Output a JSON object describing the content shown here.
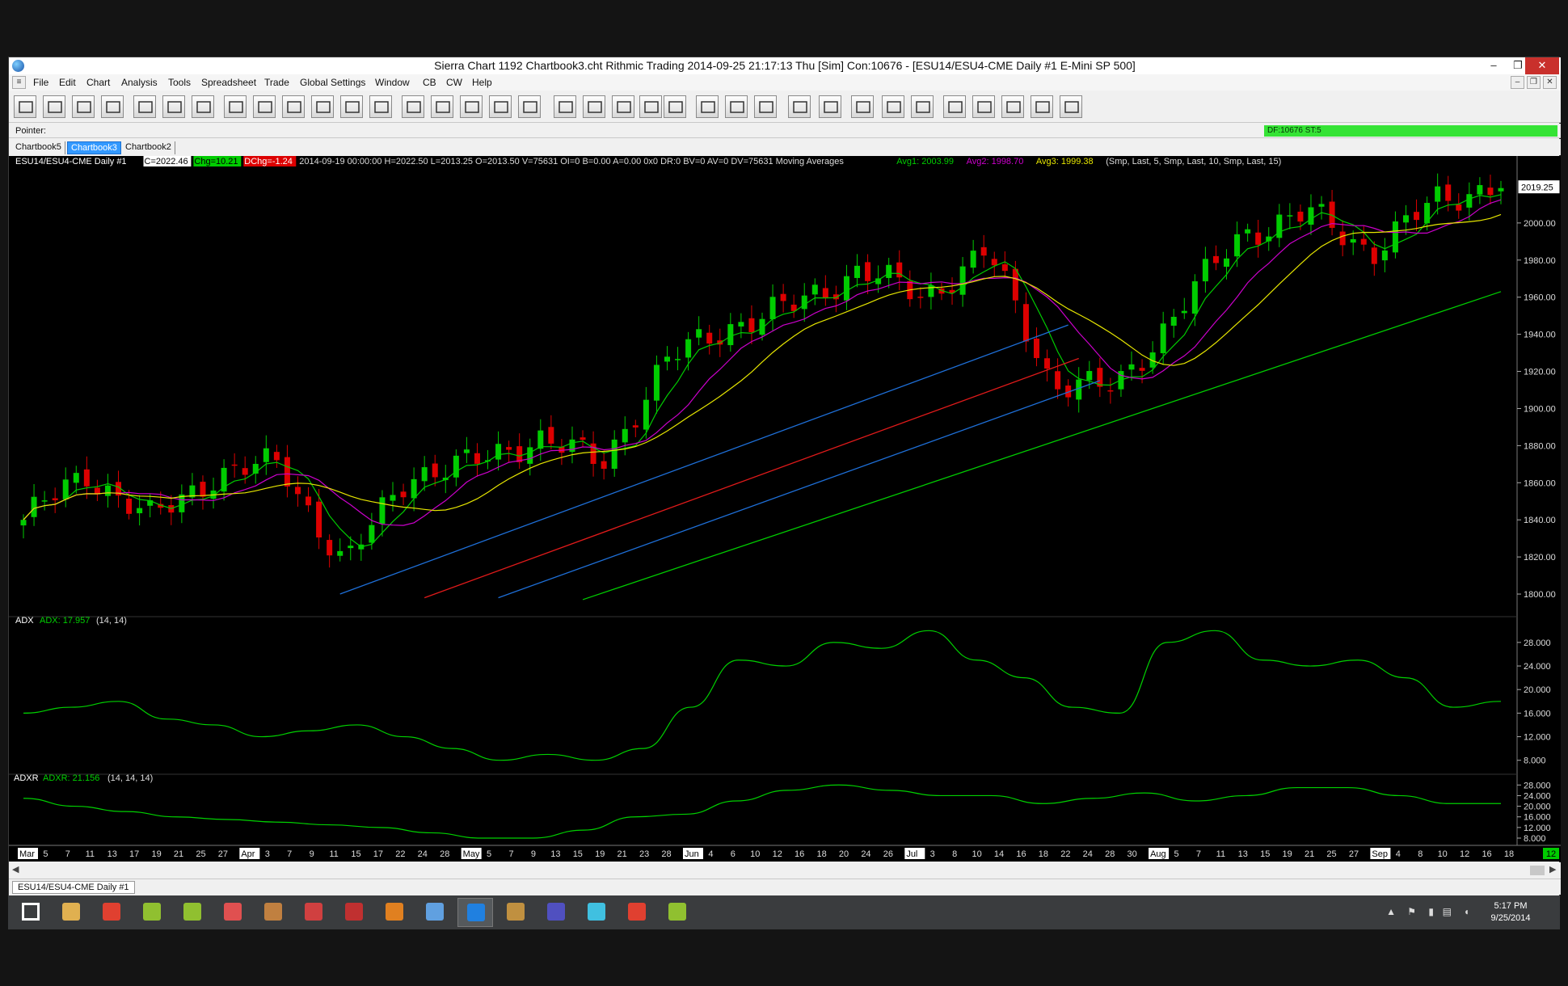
{
  "window": {
    "title": "Sierra Chart 1192 Chartbook3.cht  Rithmic Trading 2014-09-25  21:17:13 Thu [Sim]  Con:10676 - [ESU14/ESU4-CME  Daily  #1  E-Mini SP 500]",
    "minimize_glyph": "–",
    "restore_glyph": "❐",
    "close_glyph": "✕"
  },
  "menu": [
    "File",
    "Edit",
    "Chart",
    "Analysis",
    "Tools",
    "Spreadsheet",
    "Trade",
    "Global Settings",
    "Window",
    "CB",
    "CW",
    "Help"
  ],
  "pointer_bar": {
    "label": "Pointer:",
    "status": "DF:10676  ST:5",
    "status_color": "#35e335"
  },
  "tabs": [
    "Chartbook5",
    "Chartbook3",
    "Chartbook2"
  ],
  "active_tab": "Chartbook3",
  "chart": {
    "header_symbol": "ESU14/ESU4-CME  Daily  #1",
    "header_close": "C=2022.46",
    "header_change": "Chg=10.21",
    "header_pchange": "DChg=-1.24",
    "header_ohlc": "2014-09-19 00:00:00 H=2022.50 L=2013.25 O=2013.50 V=75631 OI=0 B=0.00 A=0.00 0x0 DR:0 BV=0 AV=0 DV=75631 Moving Averages",
    "avg1": "Avg1: 2003.99",
    "avg2": "Avg2: 1998.70",
    "avg3": "Avg3: 1999.38",
    "ma_params": "(Smp, Last, 5, Smp, Last, 10, Smp, Last, 15)",
    "last_price": "2019.25",
    "price_labels": [
      "2000.00",
      "1980.00",
      "1960.00",
      "1940.00",
      "1920.00",
      "1900.00",
      "1880.00",
      "1860.00",
      "1840.00",
      "1820.00",
      "1800.00"
    ],
    "adx_title": "ADX",
    "adx_value": "ADX: 17.957",
    "adx_params": "(14, 14)",
    "adx_labels": [
      "28.000",
      "24.000",
      "20.000",
      "16.000",
      "12.000",
      "8.000"
    ],
    "adxr_title": "ADXR",
    "adxr_value": "ADXR: 21.156",
    "adxr_params": "(14, 14, 14)",
    "adxr_labels": [
      "28.000",
      "24.000",
      "20.000",
      "16.000",
      "12.000",
      "8.000"
    ],
    "date_labels": [
      "Mar",
      "5",
      "7",
      "11",
      "13",
      "17",
      "19",
      "21",
      "25",
      "27",
      "Apr",
      "3",
      "7",
      "9",
      "11",
      "15",
      "17",
      "22",
      "24",
      "28",
      "May",
      "5",
      "7",
      "9",
      "13",
      "15",
      "19",
      "21",
      "23",
      "28",
      "Jun",
      "4",
      "6",
      "10",
      "12",
      "16",
      "18",
      "20",
      "24",
      "26",
      "Jul",
      "3",
      "8",
      "10",
      "14",
      "16",
      "18",
      "22",
      "24",
      "28",
      "30",
      "Aug",
      "5",
      "7",
      "11",
      "13",
      "15",
      "19",
      "21",
      "25",
      "27",
      "Sep",
      "4",
      "8",
      "10",
      "12",
      "16",
      "18"
    ],
    "corner_label": "12",
    "colors": {
      "up_candle": "#00cc00",
      "down_candle": "#dd0000",
      "avg1": "#00cc00",
      "avg2": "#cc00cc",
      "avg3": "#e6e600",
      "trend_blue": "#1e6fd8",
      "trend_red": "#e01a1a",
      "trend_green": "#00cc00",
      "indicator": "#00d000"
    }
  },
  "chart_data": {
    "type": "candlestick",
    "series": [
      {
        "name": "Avg1",
        "values": []
      },
      {
        "name": "Avg2",
        "values": []
      },
      {
        "name": "Avg3",
        "values": []
      }
    ],
    "close_anchor_points": [
      {
        "x": "Mar",
        "y": 1840
      },
      {
        "x": "Mar 7",
        "y": 1865
      },
      {
        "x": "Mar 13",
        "y": 1840
      },
      {
        "x": "Mar 21",
        "y": 1865
      },
      {
        "x": "Apr 3",
        "y": 1870
      },
      {
        "x": "Apr 11",
        "y": 1815
      },
      {
        "x": "Apr 22",
        "y": 1865
      },
      {
        "x": "May 5",
        "y": 1870
      },
      {
        "x": "May 13",
        "y": 1885
      },
      {
        "x": "May 21",
        "y": 1870
      },
      {
        "x": "Jun 4",
        "y": 1925
      },
      {
        "x": "Jun 10",
        "y": 1945
      },
      {
        "x": "Jun 20",
        "y": 1955
      },
      {
        "x": "Jul 3",
        "y": 1975
      },
      {
        "x": "Jul 10",
        "y": 1960
      },
      {
        "x": "Jul 24",
        "y": 1985
      },
      {
        "x": "Aug 5",
        "y": 1915
      },
      {
        "x": "Aug 7",
        "y": 1910
      },
      {
        "x": "Aug 15",
        "y": 1955
      },
      {
        "x": "Aug 25",
        "y": 1995
      },
      {
        "x": "Sep 4",
        "y": 2005
      },
      {
        "x": "Sep 12",
        "y": 1985
      },
      {
        "x": "Sep 18",
        "y": 2012
      },
      {
        "x": "Sep 19",
        "y": 2022
      }
    ],
    "adx": [
      16,
      17,
      18,
      15,
      14,
      12,
      13,
      14,
      12,
      10,
      8,
      9,
      8,
      10,
      17,
      25,
      24,
      28,
      27,
      30,
      25,
      22,
      17,
      16,
      28,
      30,
      25,
      24,
      25,
      22,
      17,
      18
    ],
    "adxr": [
      23,
      20,
      18,
      16,
      15,
      14,
      13,
      12,
      10,
      8,
      8,
      11,
      16,
      17,
      22,
      26,
      28,
      26,
      24,
      24,
      21,
      23,
      25,
      22,
      24,
      27,
      27,
      24,
      21,
      21
    ],
    "price_ylim": [
      1790,
      2030
    ],
    "adx_ylim": [
      7,
      31
    ],
    "adxr_ylim": [
      8,
      29
    ]
  },
  "taskbar": {
    "time": "5:17 PM",
    "date": "9/25/2014",
    "icons": [
      "start-icon",
      "file-explorer-icon",
      "chrome-icon",
      "app-icon",
      "app-icon",
      "paint-icon",
      "notebook-icon",
      "app-icon",
      "app-icon",
      "app-icon",
      "app-icon",
      "sierra-chart-icon",
      "app-icon",
      "app-icon",
      "app-icon",
      "app-icon",
      "app-icon"
    ]
  },
  "bottom_tab": "ESU14/ESU4-CME  Daily  #1"
}
